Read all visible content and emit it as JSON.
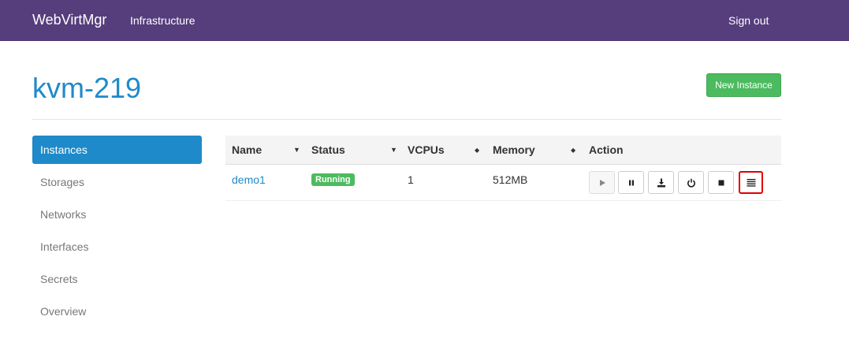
{
  "navbar": {
    "brand": "WebVirtMgr",
    "infrastructure_label": "Infrastructure",
    "signout_label": "Sign out",
    "background_color": "#563d7c"
  },
  "page": {
    "title": "kvm-219",
    "new_instance_label": "New Instance"
  },
  "sidebar": {
    "items": [
      {
        "label": "Instances",
        "active": true
      },
      {
        "label": "Storages"
      },
      {
        "label": "Networks"
      },
      {
        "label": "Interfaces"
      },
      {
        "label": "Secrets"
      },
      {
        "label": "Overview"
      }
    ]
  },
  "table": {
    "columns": [
      "Name",
      "Status",
      "VCPUs",
      "Memory",
      "Action"
    ],
    "rows": [
      {
        "name": "demo1",
        "status": "Running",
        "vcpus": "1",
        "memory": "512MB"
      }
    ],
    "action_icons": [
      "play-icon",
      "pause-icon",
      "download-icon",
      "power-icon",
      "stop-icon",
      "menu-icon"
    ]
  },
  "colors": {
    "accent": "#1f8ac9",
    "success": "#4cbb5f",
    "highlight": "#e00000"
  }
}
